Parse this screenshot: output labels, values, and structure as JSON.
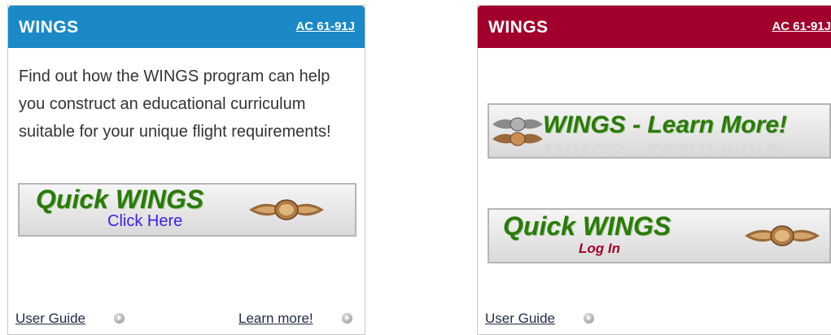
{
  "left_panel": {
    "title": "WINGS",
    "ac_link": "AC 61-91J",
    "description": "Find out how the WINGS program can help you construct an educational curriculum suitable for your unique flight requirements!",
    "quick_banner": {
      "title": "Quick WINGS",
      "subtitle": "Click Here"
    },
    "user_guide": "User Guide",
    "learn_more": "Learn more!",
    "header_color": "#1a89c6"
  },
  "right_panel": {
    "title": "WINGS",
    "ac_link": "AC 61-91J",
    "learn_banner": "WINGS - Learn More!",
    "quick_banner": {
      "title": "Quick WINGS",
      "subtitle": "Log In"
    },
    "user_guide": "User Guide",
    "header_color": "#a0002b"
  },
  "icons": {
    "wings_badge": "wings-badge-icon",
    "arrow": "arrow-circle-icon"
  }
}
